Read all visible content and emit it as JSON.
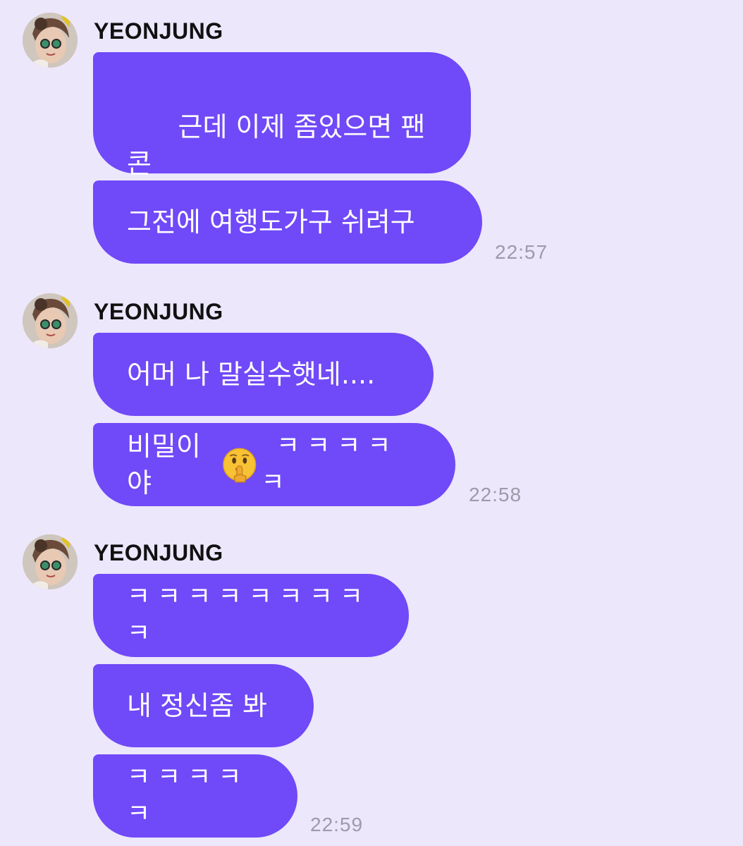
{
  "colors": {
    "background": "#ece7fb",
    "bubble": "#7049f8",
    "bubble_text": "#ffffff",
    "sender": "#111111",
    "timestamp": "#9f9aaa"
  },
  "groups": [
    {
      "sender": "YEONJUNG",
      "avatar_icon": "profile-photo",
      "messages": [
        "근데 이제 좀있으면 팬콘\n준비도 해야하니",
        "그전에 여행도가구 쉬려구"
      ],
      "time": "22:57"
    },
    {
      "sender": "YEONJUNG",
      "avatar_icon": "profile-photo",
      "messages": [
        "어머 나 말실수햇네....",
        {
          "before": "비밀이야",
          "emoji": "shushing-face",
          "after": " ㅋㅋㅋㅋㅋ"
        }
      ],
      "time": "22:58"
    },
    {
      "sender": "YEONJUNG",
      "avatar_icon": "profile-photo",
      "messages": [
        "ㅋㅋㅋㅋㅋㅋㅋㅋㅋ",
        "내 정신좀 봐",
        "ㅋㅋㅋㅋㅋ"
      ],
      "time": "22:59"
    }
  ]
}
